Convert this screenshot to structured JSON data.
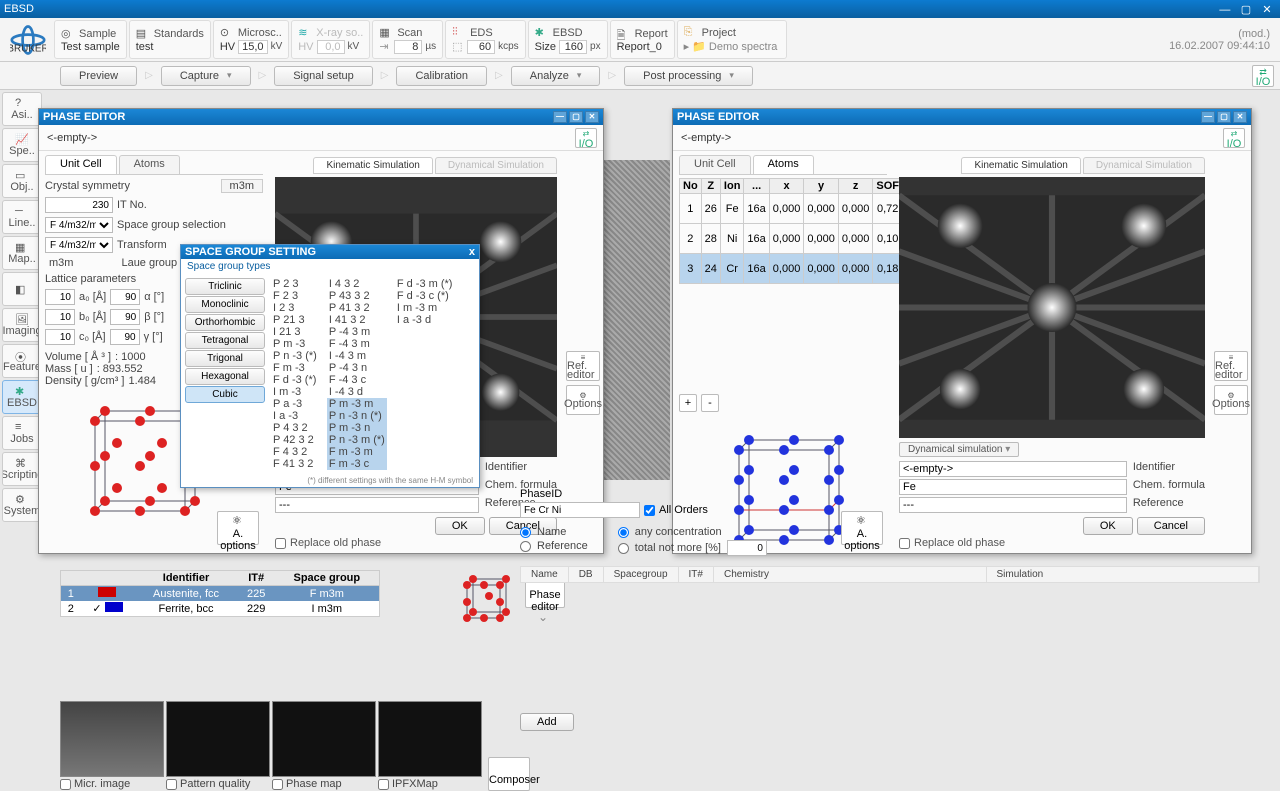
{
  "app": {
    "title": "EBSD",
    "mod": "(mod.)",
    "timestamp": "16.02.2007 09:44:10"
  },
  "ribbon": {
    "sample": {
      "label": "Sample",
      "value": "Test sample"
    },
    "stds": {
      "label": "Standards",
      "value": "test"
    },
    "micro": {
      "label": "Microsc..",
      "hv": "HV",
      "val": "15,0",
      "unit": "kV"
    },
    "xray": {
      "label": "X-ray so..",
      "hv": "HV",
      "val": "0,0",
      "unit": "kV"
    },
    "scan": {
      "label": "Scan",
      "val": "8",
      "unit": "µs"
    },
    "eds": {
      "label": "EDS",
      "val": "60",
      "unit": "kcps"
    },
    "ebsd": {
      "label": "EBSD",
      "prm": "Size",
      "val": "160",
      "unit": "px"
    },
    "report": {
      "label": "Report",
      "value": "Report_0"
    },
    "project": {
      "label": "Project",
      "value": "Demo spectra"
    }
  },
  "subbar": [
    "Preview",
    "Capture",
    "Signal setup",
    "Calibration",
    "Analyze",
    "Post processing"
  ],
  "leftcol": [
    "Asi..",
    "Spe..",
    "Obj..",
    "Line..",
    "Map..",
    "",
    "Imaging",
    "Feature",
    "EBSD",
    "Jobs",
    "Scripting",
    "System"
  ],
  "pw": {
    "title": "PHASE EDITOR",
    "empty": "<-empty->",
    "tabs": [
      "Unit Cell",
      "Atoms"
    ],
    "simtabs": [
      "Kinematic Simulation",
      "Dynamical Simulation"
    ],
    "crystal": {
      "sym": "Crystal symmetry",
      "m3m": "m3m",
      "it": "IT No.",
      "itval": "230",
      "sg": "Space group selection",
      "sel1": "F 4/m32/m",
      "sel2": "F 4/m32/m",
      "trans": "Transform",
      "laue": "Laue group"
    },
    "lattice": {
      "hdr": "Lattice parameters",
      "a": "10",
      "au": "a₀ [Å]",
      "alpha": "90",
      "alphau": "α [°]",
      "b": "10",
      "bu": "b₀ [Å]",
      "beta": "90",
      "betau": "β [°]",
      "c": "10",
      "cu": "c₀ [Å]",
      "gamma": "90",
      "gammau": "γ [°]"
    },
    "props": {
      "vol_l": "Volume [ Å ³ ]",
      "vol_v": ": 1000",
      "mass_l": "Mass [ u ]",
      "mass_v": ": 893.552",
      "den_l": "Density [ g/cm³ ]",
      "den_v": "1.484"
    },
    "dyn": "Dynamical simulation",
    "ident": {
      "id": "Identifier",
      "cf": "Chem. formula",
      "ref": "Reference",
      "idv": "<-empty->",
      "cfv": "Fe",
      "refv": "---"
    },
    "ok": "OK",
    "cancel": "Cancel",
    "replace": "Replace old phase",
    "ref_editor": "Ref. editor",
    "options": "Options",
    "aopt": "A. options"
  },
  "sg": {
    "title": "SPACE GROUP SETTING",
    "sub": "Space group types",
    "systems": [
      "Triclinic",
      "Monoclinic",
      "Orthorhombic",
      "Tetragonal",
      "Trigonal",
      "Hexagonal",
      "Cubic"
    ],
    "col1": [
      "P 2 3",
      "F 2 3",
      "I 2 3",
      "P 21 3",
      "I 21 3",
      "P m -3",
      "P n -3 (*)",
      "F m -3",
      "F d -3 (*)",
      "I m -3",
      "P a -3",
      "I a -3",
      "P 4 3 2",
      "P 42 3 2",
      "F 4 3 2",
      "F 41 3 2"
    ],
    "col2": [
      "I 4 3 2",
      "P 43 3 2",
      "P 41 3 2",
      "I 41 3 2",
      "P -4 3 m",
      "F -4 3 m",
      "I -4 3 m",
      "P -4 3 n",
      "F -4 3 c",
      "I -4 3 d",
      "P m -3 m",
      "P n -3 n (*)",
      "P m -3 n",
      "P n -3 m (*)",
      "F m -3 m",
      "F m -3 c"
    ],
    "col3": [
      "F d -3 m (*)",
      "F d -3 c (*)",
      "I m -3 m",
      "I a -3 d"
    ],
    "foot": "(*) different settings with the same H-M symbol",
    "close": "x"
  },
  "atoms": {
    "hdr": [
      "No",
      "Z",
      "Ion",
      "...",
      "x",
      "y",
      "z",
      "SOF",
      ""
    ],
    "rows": [
      {
        "n": "1",
        "z": "26",
        "el": "Fe",
        "w": "16a",
        "x": "0,000",
        "y": "0,000",
        "zv": "0,000",
        "s": "0,72",
        "c": "#c00"
      },
      {
        "n": "2",
        "z": "28",
        "el": "Ni",
        "w": "16a",
        "x": "0,000",
        "y": "0,000",
        "zv": "0,000",
        "s": "0,10",
        "c": "#0a0"
      },
      {
        "n": "3",
        "z": "24",
        "el": "Cr",
        "w": "16a",
        "x": "0,000",
        "y": "0,000",
        "zv": "0,000",
        "s": "0,18",
        "c": "#00c"
      }
    ],
    "plus": "+",
    "minus": "-"
  },
  "phaselist": {
    "hdr": [
      "",
      "",
      "Identifier",
      "IT#",
      "Space group"
    ],
    "rows": [
      {
        "n": "1",
        "c": "#c00",
        "id": "Austenite, fcc",
        "it": "225",
        "sg": "F m3m"
      },
      {
        "n": "2",
        "c": "#00c",
        "id": "Ferrite, bcc",
        "it": "229",
        "sg": "I m3m"
      }
    ],
    "pe": "Phase editor"
  },
  "thumbs": [
    "Micr. image",
    "Pattern quality",
    "Phase map",
    "IPFXMap"
  ],
  "composer": "Composer",
  "mid": {
    "phaseid": "PhaseID",
    "fecrni": "Fe Cr Ni",
    "allorders": "All Orders",
    "name": "Name",
    "reference": "Reference",
    "anyc": "any concentration",
    "totn": "total not more [%]",
    "pct": "0",
    "cols": [
      "Name",
      "DB",
      "Spacegroup",
      "IT#",
      "Chemistry",
      "Simulation"
    ],
    "add": "Add"
  },
  "io": "I/O"
}
